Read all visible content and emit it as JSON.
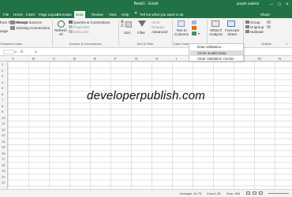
{
  "window": {
    "title": "Book1 - Excel",
    "user": "praeth sathish",
    "colors": {
      "brand": "#217346",
      "ribbon": "#f3f3f3"
    }
  },
  "tabs": [
    "File",
    "Home",
    "Insert",
    "Page Layout",
    "Formulas",
    "Data",
    "Review",
    "View",
    "Help"
  ],
  "active_tab": "Data",
  "tell_me": "Tell me what you want to do",
  "share_label": "Share",
  "ribbon": {
    "get_transform": {
      "items": [
        "Recent Sources",
        "Existing Connections"
      ],
      "cut_items": [
        "from Table/Range",
        "ange"
      ],
      "group_label": "Transform Data"
    },
    "queries": {
      "refresh_label": "Refresh All",
      "items": [
        "Queries & Connections",
        "Properties",
        "Edit Links"
      ],
      "group_label": "Queries & Connections"
    },
    "sort_filter": {
      "sort_label": "Sort",
      "filter_label": "Filter",
      "items": [
        "Clear",
        "Reapply",
        "Advanced"
      ],
      "group_label": "Sort & Filter"
    },
    "data_tools": {
      "text_to_columns": "Text to Columns",
      "group_label": "Data Tools"
    },
    "forecast": {
      "whatif_label": "What-If Analysis",
      "forecast_label": "Forecast Sheet",
      "group_label": "Forecast"
    },
    "outline": {
      "items": [
        "Group",
        "Ungroup",
        "Subtotal"
      ],
      "group_label": "Outline"
    }
  },
  "formula_bar": {
    "fx": "fx",
    "value": "1"
  },
  "columns": [
    "A",
    "B",
    "C",
    "D",
    "E",
    "F",
    "G",
    "H",
    "I",
    "J",
    "K",
    "L",
    "M",
    "N"
  ],
  "rows": [
    "1",
    "2",
    "3",
    "4",
    "5",
    "6",
    "7",
    "8",
    "9",
    "10",
    "11",
    "12",
    "13",
    "14",
    "15",
    "16",
    "17",
    "18",
    "19",
    "20",
    "21"
  ],
  "dropdown": {
    "items": [
      "Data Validation...",
      "Circle Invalid Data",
      "Clear Validation Circles"
    ],
    "highlighted": 1
  },
  "watermark": "developerpublish.com",
  "status": {
    "average": "Average: 24.75",
    "count": "Count: 28",
    "sum": "Sum: 594"
  }
}
